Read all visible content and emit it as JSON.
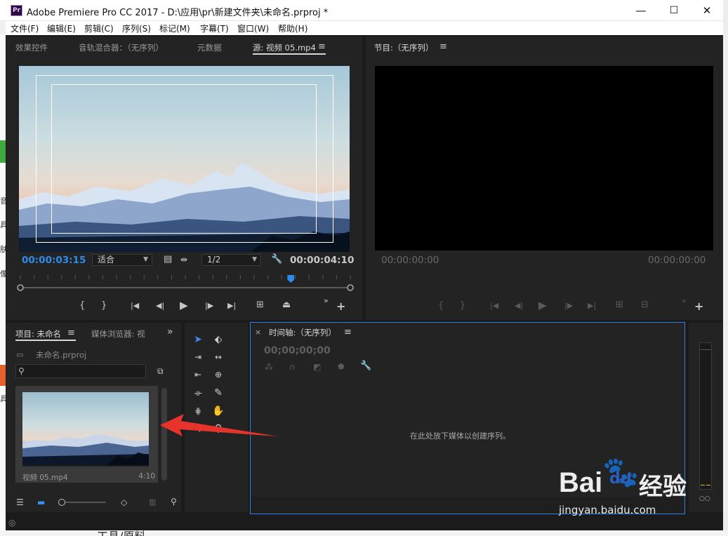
{
  "window": {
    "app_icon_text": "Pr",
    "title": "Adobe Premiere Pro CC 2017 - D:\\应用\\pr\\新建文件夹\\未命名.prproj *",
    "minimize": "—",
    "maximize": "☐",
    "close": "✕"
  },
  "menu": [
    "文件(F)",
    "编辑(E)",
    "剪辑(C)",
    "序列(S)",
    "标记(M)",
    "字幕(T)",
    "窗口(W)",
    "帮助(H)"
  ],
  "source_panel": {
    "tabs": [
      "效果控件",
      "音轨混合器：（无序列）",
      "元数据",
      "源: 视频 05.mp4"
    ],
    "menu_icon": "≡",
    "timecode_current": "00:00:03:15",
    "fit_select": "适合",
    "resolution_select": "1/2",
    "timecode_duration": "00:00:04:10",
    "playhead_fraction": 0.82
  },
  "program_panel": {
    "title": "节目:（无序列）",
    "menu_icon": "≡",
    "timecode_left": "00:00:00:00",
    "timecode_right": "00:00:00:00"
  },
  "project_panel": {
    "tabs": [
      "项目: 未命名",
      "媒体浏览器: 视"
    ],
    "menu_icon": "≡",
    "overflow": "»",
    "file_name": "未命名.prproj",
    "clip_name": "视频 05.mp4",
    "clip_duration": "4:10"
  },
  "timeline_panel": {
    "title": "时间轴:（无序列）",
    "close": "×",
    "menu_icon": "≡",
    "timecode": "00;00;00;00",
    "drop_hint": "在此处放下媒体以创建序列。"
  },
  "watermark": {
    "brand": "Bai",
    "brand_tail": "du",
    "cn": "经验",
    "url": "jingyan.baidu.com"
  },
  "background_window_text": [
    "音",
    "具",
    "肤",
    "像",
    "具"
  ],
  "background_bottom_text": "工具/原料",
  "colors": {
    "accent_blue": "#2d8ceb",
    "arrow_red": "#e8332d",
    "panel_bg": "#232323",
    "workspace_bg": "#1b1b1b"
  }
}
